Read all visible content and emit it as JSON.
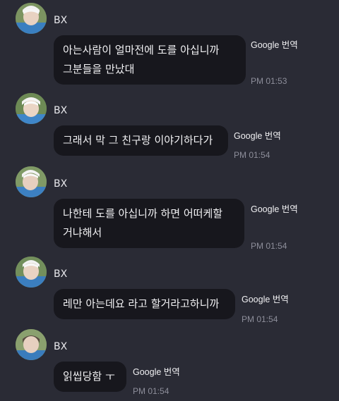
{
  "messages": [
    {
      "sender": "BX",
      "text": "아는사람이 얼마전에 도를 아십니까\n그분들을 만났대",
      "translate_label": "Google 번역",
      "time": "PM 01:53"
    },
    {
      "sender": "BX",
      "text": "그래서 막 그 친구랑 이야기하다가",
      "translate_label": "Google 번역",
      "time": "PM 01:54"
    },
    {
      "sender": "BX",
      "text": "나한테 도를 아십니까 하면 어떠케할\n거냐해서",
      "translate_label": "Google 번역",
      "time": "PM 01:54"
    },
    {
      "sender": "BX",
      "text": "레만 아는데요 라고 할거라고하니까",
      "translate_label": "Google 번역",
      "time": "PM 01:54"
    },
    {
      "sender": "BX",
      "text": "읽씹당함 ㅜ",
      "translate_label": "Google 번역",
      "time": "PM 01:54"
    }
  ],
  "colors": {
    "background": "#2a2b35",
    "bubble": "#17171d",
    "timestamp": "#8d8e9a"
  }
}
